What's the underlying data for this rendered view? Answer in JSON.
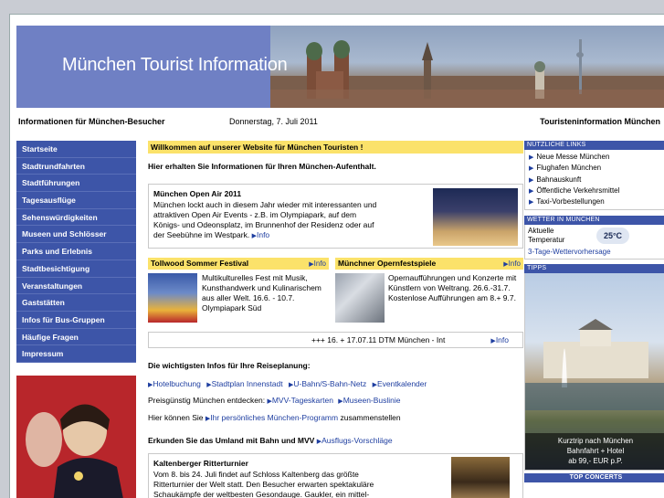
{
  "banner": {
    "title": "München Tourist Information"
  },
  "header": {
    "left": "Informationen für München-Besucher",
    "date": "Donnerstag, 7. Juli 2011",
    "right": "Touristeninformation München"
  },
  "sidebar": {
    "items": [
      {
        "label": "Startseite"
      },
      {
        "label": "Stadtrundfahrten"
      },
      {
        "label": "Stadtführungen"
      },
      {
        "label": "Tagesausflüge"
      },
      {
        "label": "Sehenswürdigkeiten"
      },
      {
        "label": "Museen und Schlösser"
      },
      {
        "label": "Parks und Erlebnis"
      },
      {
        "label": "Stadtbesichtigung"
      },
      {
        "label": "Veranstaltungen"
      },
      {
        "label": "Gaststätten"
      },
      {
        "label": "Infos für Bus-Gruppen"
      },
      {
        "label": "Häufige Fragen"
      },
      {
        "label": "Impressum"
      }
    ]
  },
  "main": {
    "welcome": "Willkommen auf unserer Website für München Touristen !",
    "intro": "Hier erhalten Sie Informationen für Ihren München-Aufenthalt.",
    "open_air": {
      "title": "München Open Air 2011",
      "text": "München lockt auch in diesem Jahr wieder mit interessanten und attraktiven Open Air Events - z.B. im Olympiapark, auf dem Königs- und Odeonsplatz, im Brunnenhof der Residenz oder auf der Seebühne im Westpark.",
      "link": "Info"
    },
    "tollwood": {
      "title": "Tollwood Sommer Festival",
      "info": "Info",
      "text": "Multikulturelles Fest mit Musik, Kunsthandwerk und Kulinarischem aus aller Welt. 16.6. - 10.7. Olympiapark Süd"
    },
    "oper": {
      "title": "Münchner Opernfestspiele",
      "info": "Info",
      "text": "Opernaufführungen und Konzerte mit Künstlern von Weltrang. 26.6.-31.7. Kostenlose Aufführungen am 8.+ 9.7."
    },
    "ticker": {
      "text": "+++ 16. + 17.07.11 DTM München - Int",
      "link": "Info"
    },
    "planning": {
      "heading": "Die wichtigsten Infos für Ihre Reiseplanung:",
      "links": [
        "Hotelbuchung",
        "Stadtplan Innenstadt",
        "U-Bahn/S-Bahn-Netz",
        "Eventkalender"
      ],
      "cheap_label": "Preisgünstig München entdecken:",
      "cheap_links": [
        "MVV-Tageskarten",
        "Museen-Buslinie"
      ],
      "own_prefix": "Hier können Sie",
      "own_link": "Ihr persönliches München-Programm",
      "own_suffix": "zusammenstellen",
      "region_label": "Erkunden Sie das Umland mit Bahn und MVV",
      "region_link": "Ausflugs-Vorschläge"
    },
    "ritter": {
      "title": "Kaltenberger Ritterturnier",
      "text": "Vom 8. bis 24. Juli findet auf Schloss Kaltenberg das größte Ritterturnier der Welt statt. Den Besucher erwarten spektakuläre Schaukämpfe der weltbesten Gesondauge. Gaukler, ein mittel-"
    }
  },
  "right": {
    "links_head": "NÜTZLICHE LINKS",
    "links": [
      "Neue Messe München",
      "Flughafen München",
      "Bahnauskunft",
      "Öffentliche Verkehrsmittel",
      "Taxi-Vorbestellungen"
    ],
    "weather_head": "WETTER IN MÜNCHEN",
    "weather_label_1": "Aktuelle",
    "weather_label_2": "Temperatur",
    "weather_temp": "25°C",
    "weather_link": "3-Tage-Wettervorhersage",
    "tipps_head": "TIPPS",
    "tipps_caption_1": "Kurztrip nach München",
    "tipps_caption_2": "Bahnfahrt + Hotel",
    "tipps_caption_3": "ab 99,- EUR p.P.",
    "concerts_head": "TOP CONCERTS"
  }
}
